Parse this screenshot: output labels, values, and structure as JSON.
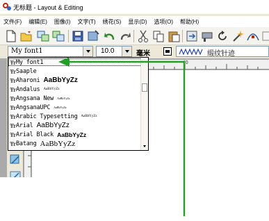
{
  "window": {
    "title": "无标题 - Layout & Editing"
  },
  "menu": {
    "items": [
      "文件(F)",
      "编辑(E)",
      "图像(I)",
      "文字(T)",
      "绣花(S)",
      "显示(D)",
      "选项(O)",
      "帮助(H)"
    ]
  },
  "format_bar": {
    "font_value": "My font1",
    "size_value": "10.0",
    "unit_label": "毫米",
    "stitch_label": "缎纹针迹"
  },
  "ruler": {
    "mark": "|0"
  },
  "font_list": [
    {
      "name": "My font1",
      "sample": ""
    },
    {
      "name": "Saaple",
      "sample": ""
    },
    {
      "name": "Aharoni",
      "sample": "AaBbYyZz"
    },
    {
      "name": "Andalus",
      "sample": "AaBbYyZz"
    },
    {
      "name": "Angsana New",
      "sample": "AaBbYyZz"
    },
    {
      "name": "AngsanaUPC",
      "sample": "AaBbYyZz"
    },
    {
      "name": "Arabic Typesetting",
      "sample": "AaBbYyZz"
    },
    {
      "name": "Arial",
      "sample": "AaBbYyZz"
    },
    {
      "name": "Arial Black",
      "sample": "AaBbYyZz"
    },
    {
      "name": "Batang",
      "sample": "AaBbYyZz"
    }
  ],
  "font_icon_text": "Ŧr",
  "colors": {
    "annotation": "#1ea020",
    "selection_outline": "#000000"
  }
}
